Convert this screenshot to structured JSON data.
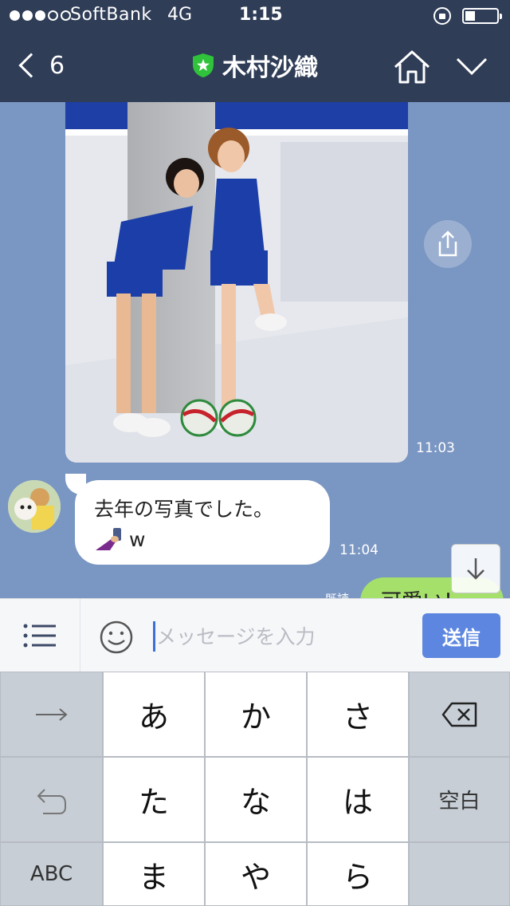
{
  "status_bar": {
    "carrier": "SoftBank",
    "network": "4G",
    "time": "1:15"
  },
  "header": {
    "back_count": "6",
    "title": "木村沙織",
    "colors": {
      "bar": "#2f3d57",
      "shield": "#2fc23a"
    }
  },
  "chat": {
    "photo_time": "11:03",
    "incoming_message": {
      "line1": "去年の写真でした。",
      "line2": "w",
      "time": "11:04"
    },
    "outgoing_message": {
      "read": "既読",
      "text": "可愛い！"
    },
    "colors": {
      "background": "#7a96c2",
      "outgoing_bubble": "#a5e06b"
    }
  },
  "input_bar": {
    "placeholder": "メッセージを入力",
    "send_label": "送信"
  },
  "keyboard": {
    "row1": [
      "→",
      "あ",
      "か",
      "さ",
      "⌫"
    ],
    "row2": [
      "↺",
      "た",
      "な",
      "は",
      "空白"
    ],
    "row3": [
      "ABC",
      "ま",
      "や",
      "ら",
      ""
    ]
  },
  "icons": [
    "back-chevron-icon",
    "shield-star-icon",
    "home-icon",
    "chevron-down-icon",
    "share-icon",
    "arrow-down-icon",
    "list-menu-icon",
    "smiley-icon",
    "delete-icon"
  ]
}
